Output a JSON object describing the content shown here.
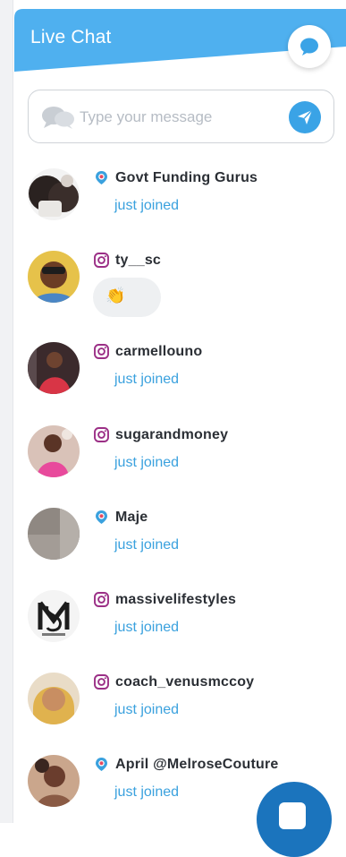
{
  "header": {
    "title": "Live Chat",
    "chat_icon": "chat-bubble-icon"
  },
  "composer": {
    "placeholder": "Type your message",
    "left_icon": "chat-bubbles-icon",
    "send_icon": "send-icon"
  },
  "colors": {
    "accent": "#3aa3e6",
    "link": "#3aa1de",
    "fab": "#1b74bd",
    "instagram": "#9b2f86",
    "periscope": "#3aa1de"
  },
  "messages": [
    {
      "source": "periscope-icon",
      "username": "Govt Funding Gurus",
      "status": "just joined"
    },
    {
      "source": "instagram-icon",
      "username": "ty__sc",
      "emoji": "👏"
    },
    {
      "source": "instagram-icon",
      "username": "carmellouno",
      "status": "just joined"
    },
    {
      "source": "instagram-icon",
      "username": "sugarandmoney",
      "status": "just joined"
    },
    {
      "source": "periscope-icon",
      "username": "Maje",
      "status": "just joined"
    },
    {
      "source": "instagram-icon",
      "username": "massivelifestyles",
      "status": "just joined"
    },
    {
      "source": "instagram-icon",
      "username": "coach_venusmccoy",
      "status": "just joined"
    },
    {
      "source": "periscope-icon",
      "username": "April @MelroseCouture",
      "status": "just joined"
    }
  ]
}
